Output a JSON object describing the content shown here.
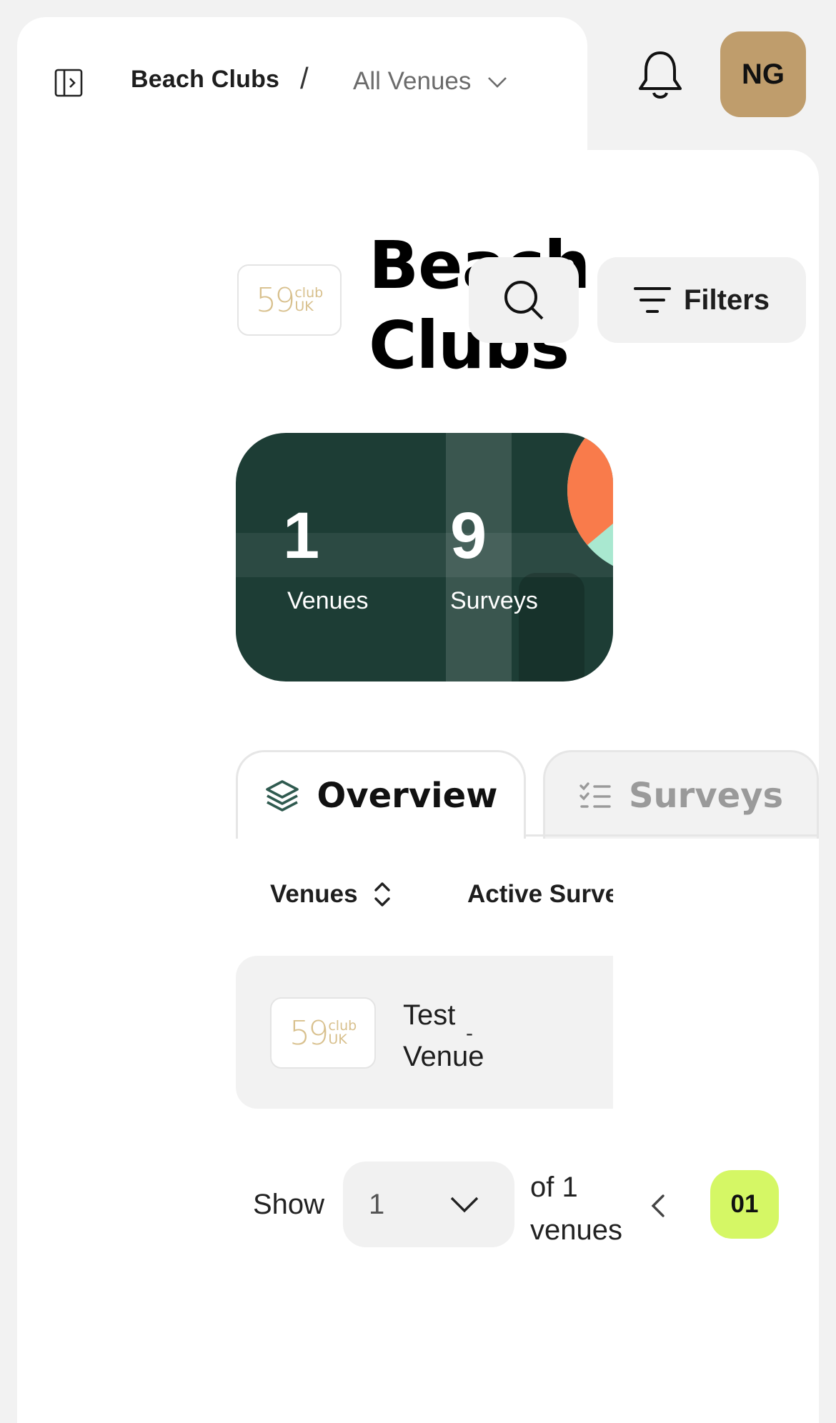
{
  "breadcrumb": {
    "root": "Beach Clubs",
    "separator": "/",
    "current": "All Venues"
  },
  "header": {
    "avatar_initials": "NG",
    "avatar_color": "#bf9d6c"
  },
  "brand": {
    "logo_number": "59",
    "logo_top": "club",
    "logo_bottom": "UK"
  },
  "page": {
    "title": "Beach Clubs"
  },
  "toolbar": {
    "filters_label": "Filters"
  },
  "stats": {
    "venues_count": "1",
    "venues_label": "Venues",
    "surveys_count": "9",
    "surveys_label": "Surveys",
    "card_color": "#1d3d35",
    "pie_colors": [
      "#f97b4b",
      "#a9e8d0"
    ]
  },
  "tabs": [
    {
      "label": "Overview",
      "icon": "layers-icon",
      "active": true
    },
    {
      "label": "Surveys",
      "icon": "checklist-icon",
      "active": false
    }
  ],
  "table": {
    "columns": [
      "Venues",
      "Active Surve"
    ],
    "rows": [
      {
        "name": "Test Venue",
        "active_surveys": "-"
      }
    ]
  },
  "pagination": {
    "show_label": "Show",
    "page_size": "1",
    "of_text": "of 1 venues",
    "current_page": "01",
    "accent_color": "#d5f765"
  }
}
